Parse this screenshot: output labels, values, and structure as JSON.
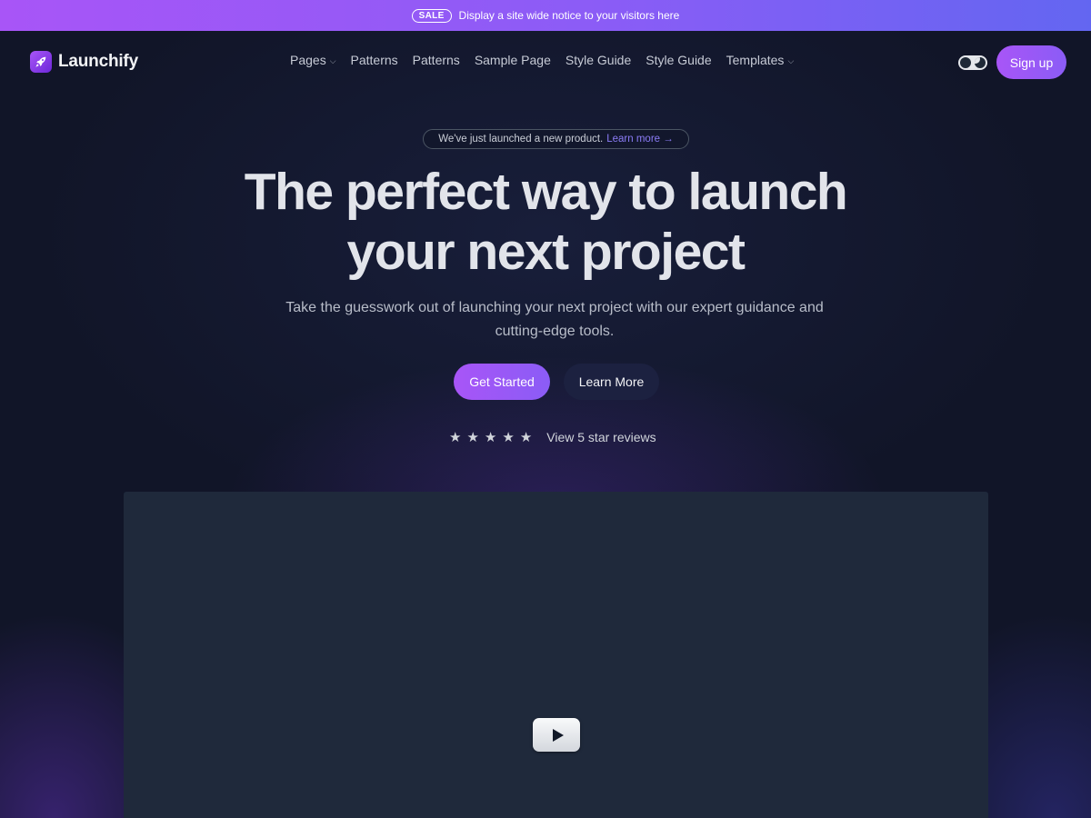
{
  "notice": {
    "badge": "SALE",
    "text": "Display a site wide notice to your visitors here"
  },
  "header": {
    "logo_text": "Launchify",
    "nav": [
      {
        "label": "Pages",
        "has_dropdown": true
      },
      {
        "label": "Patterns",
        "has_dropdown": false
      },
      {
        "label": "Patterns",
        "has_dropdown": false
      },
      {
        "label": "Sample Page",
        "has_dropdown": false
      },
      {
        "label": "Style Guide",
        "has_dropdown": false
      },
      {
        "label": "Style Guide",
        "has_dropdown": false
      },
      {
        "label": "Templates",
        "has_dropdown": true
      }
    ],
    "signup_label": "Sign up"
  },
  "hero": {
    "announcement_text": "We've just launched a new product.",
    "announcement_link": "Learn more →",
    "headline_line1": "The perfect way to launch",
    "headline_line2": "your next project",
    "subtitle": "Take the guesswork out of launching your next project with our expert guidance and cutting-edge tools.",
    "primary_button": "Get Started",
    "secondary_button": "Learn More",
    "rating": 5,
    "reviews_label": "View 5 star reviews"
  },
  "icons": {
    "logo": "rocket-icon",
    "theme_toggle": "theme-toggle-icon",
    "star": "star-icon",
    "play": "play-icon",
    "dropdown": "chevron-down-icon"
  },
  "colors": {
    "accent": "#a855f7",
    "accent_secondary": "#8b5cf6",
    "notice_gradient_end": "#6366f1",
    "background": "#121729",
    "video_placeholder": "#1f293b"
  }
}
